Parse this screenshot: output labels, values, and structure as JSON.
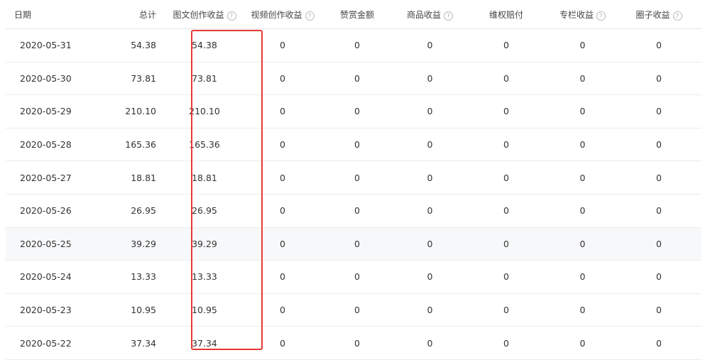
{
  "table": {
    "headers": [
      {
        "label": "日期",
        "help": false
      },
      {
        "label": "总计",
        "help": false
      },
      {
        "label": "图文创作收益",
        "help": true
      },
      {
        "label": "视频创作收益",
        "help": true
      },
      {
        "label": "赞赏金额",
        "help": false
      },
      {
        "label": "商品收益",
        "help": true
      },
      {
        "label": "维权赔付",
        "help": false
      },
      {
        "label": "专栏收益",
        "help": true
      },
      {
        "label": "圈子收益",
        "help": true
      }
    ],
    "help_glyph": "?",
    "rows": [
      [
        "2020-05-31",
        "54.38",
        "54.38",
        "0",
        "0",
        "0",
        "0",
        "0",
        "0"
      ],
      [
        "2020-05-30",
        "73.81",
        "73.81",
        "0",
        "0",
        "0",
        "0",
        "0",
        "0"
      ],
      [
        "2020-05-29",
        "210.10",
        "210.10",
        "0",
        "0",
        "0",
        "0",
        "0",
        "0"
      ],
      [
        "2020-05-28",
        "165.36",
        "165.36",
        "0",
        "0",
        "0",
        "0",
        "0",
        "0"
      ],
      [
        "2020-05-27",
        "18.81",
        "18.81",
        "0",
        "0",
        "0",
        "0",
        "0",
        "0"
      ],
      [
        "2020-05-26",
        "26.95",
        "26.95",
        "0",
        "0",
        "0",
        "0",
        "0",
        "0"
      ],
      [
        "2020-05-25",
        "39.29",
        "39.29",
        "0",
        "0",
        "0",
        "0",
        "0",
        "0"
      ],
      [
        "2020-05-24",
        "13.33",
        "13.33",
        "0",
        "0",
        "0",
        "0",
        "0",
        "0"
      ],
      [
        "2020-05-23",
        "10.95",
        "10.95",
        "0",
        "0",
        "0",
        "0",
        "0",
        "0"
      ],
      [
        "2020-05-22",
        "37.34",
        "37.34",
        "0",
        "0",
        "0",
        "0",
        "0",
        "0"
      ]
    ]
  },
  "colors": {
    "highlight": "#e53935",
    "text": "#333333",
    "row_border": "#ececec"
  },
  "icons": {
    "help": "question-circle-icon"
  }
}
